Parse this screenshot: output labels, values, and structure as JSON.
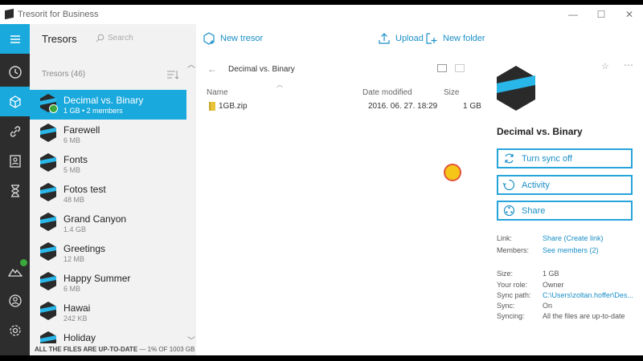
{
  "window": {
    "title": "Tresorit for Business",
    "controls": [
      "—",
      "☐",
      "✕"
    ]
  },
  "rail": {
    "items": [
      "menu-icon",
      "recent-icon",
      "tresors-icon",
      "links-icon",
      "contacts-icon",
      "activity-icon",
      "sync-icon",
      "account-icon",
      "settings-icon"
    ]
  },
  "list": {
    "title": "Tresors",
    "search_placeholder": "Search",
    "count_label": "Tresors (46)",
    "items": [
      {
        "name": "Decimal vs. Binary",
        "meta": "1 GB • 2 members"
      },
      {
        "name": "Farewell",
        "meta": "6 MB"
      },
      {
        "name": "Fonts",
        "meta": "5 MB"
      },
      {
        "name": "Fotos test",
        "meta": "48 MB"
      },
      {
        "name": "Grand Canyon",
        "meta": "1.4 GB"
      },
      {
        "name": "Greetings",
        "meta": "12 MB"
      },
      {
        "name": "Happy Summer",
        "meta": "6 MB"
      },
      {
        "name": "Hawai",
        "meta": "242 KB"
      },
      {
        "name": "Holiday",
        "meta": ""
      }
    ],
    "footer_status": "ALL THE FILES ARE UP-TO-DATE",
    "footer_usage": "— 1% OF 1003 GB"
  },
  "toolbar": {
    "new_tresor": "New tresor",
    "upload": "Upload",
    "new_folder": "New folder"
  },
  "files": {
    "breadcrumb": "Decimal vs. Binary",
    "columns": {
      "name": "Name",
      "date": "Date modified",
      "size": "Size"
    },
    "rows": [
      {
        "name": "1GB.zip",
        "date": "2016. 06. 27. 18:29",
        "size": "1 GB"
      }
    ]
  },
  "detail": {
    "title": "Decimal vs. Binary",
    "actions": {
      "sync": "Turn sync off",
      "activity": "Activity",
      "share": "Share"
    },
    "props": {
      "link_label": "Link:",
      "link_value": "Share (Create link)",
      "members_label": "Members:",
      "members_value": "See members (2)",
      "size_label": "Size:",
      "size_value": "1 GB",
      "role_label": "Your role:",
      "role_value": "Owner",
      "path_label": "Sync path:",
      "path_value": "C:\\Users\\zoltan.hoffer\\Des...",
      "sync_label": "Sync:",
      "sync_value": "On",
      "syncing_label": "Syncing:",
      "syncing_value": "All the files are up-to-date"
    }
  },
  "colors": {
    "accent": "#1aa9dd",
    "rail": "#2d2d2d",
    "link": "#1a8fc7"
  }
}
